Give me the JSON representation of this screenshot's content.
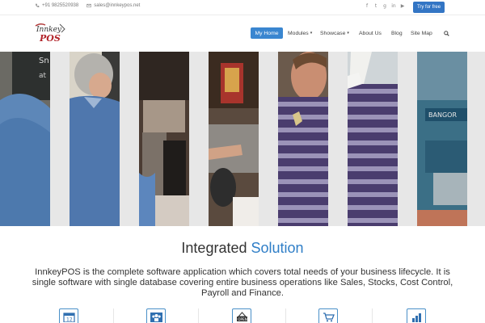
{
  "topbar": {
    "phone": "+91 9825520938",
    "email": "sales@innkeypos.net",
    "socials": [
      "facebook-icon",
      "twitter-icon",
      "google-plus-icon",
      "linkedin-icon",
      "youtube-icon"
    ],
    "try_label": "Try for free"
  },
  "logo": {
    "line1": "Innkey",
    "line2": "POS"
  },
  "nav": {
    "items": [
      {
        "label": "My Home",
        "active": true
      },
      {
        "label": "Modules",
        "dropdown": true
      },
      {
        "label": "Showcase",
        "dropdown": true
      },
      {
        "label": "About Us"
      },
      {
        "label": "Blog"
      },
      {
        "label": "Site Map"
      }
    ]
  },
  "hero": {
    "image_strips": 7
  },
  "section": {
    "title_plain": "Integrated",
    "title_accent": "Solution",
    "description": "InnkeyPOS is the complete software application which covers total needs of your business lifecycle. It is single software with single database covering entire business operations like Sales, Stocks, Cost Control, Payroll and Finance."
  },
  "features": [
    "calendar-icon",
    "users-icon",
    "open-sign-icon",
    "cart-icon",
    "bar-chart-icon"
  ],
  "colors": {
    "accent": "#2f7ec7",
    "button": "#3375c4",
    "nav_active": "#3a86d0"
  }
}
